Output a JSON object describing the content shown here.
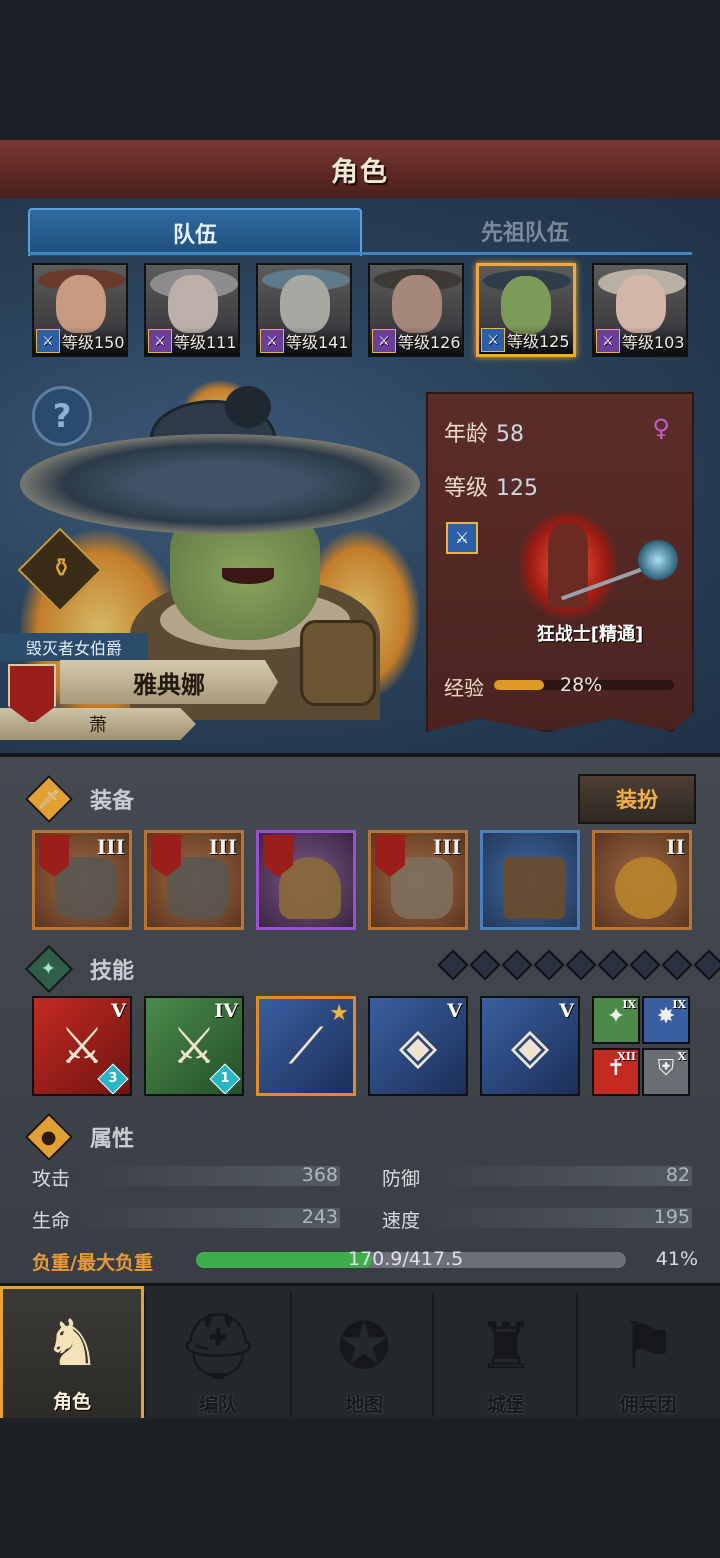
{
  "header": {
    "title": "角色"
  },
  "tabs": [
    {
      "label": "队伍"
    },
    {
      "label": "先祖队伍"
    }
  ],
  "roster": [
    {
      "level_text": "等级150",
      "class_color": "blue"
    },
    {
      "level_text": "等级111",
      "class_color": "purple"
    },
    {
      "level_text": "等级141",
      "class_color": "purple"
    },
    {
      "level_text": "等级126",
      "class_color": "purple"
    },
    {
      "level_text": "等级125",
      "class_color": "blue",
      "selected": true
    },
    {
      "level_text": "等级103",
      "class_color": "purple"
    }
  ],
  "character": {
    "title": "毁灭者女伯爵",
    "name": "雅典娜",
    "subname": "萧",
    "info": {
      "age_label": "年龄",
      "age": "58",
      "level_label": "等级",
      "level": "125",
      "gender_icon": "♀",
      "class_name": "狂战士[精通]",
      "exp_label": "经验",
      "exp_percent": "28%",
      "exp_fraction": 0.28
    }
  },
  "equipment": {
    "label": "装备",
    "dress_button": "装扮",
    "items": [
      {
        "name": "equip-spiked-pauldron-1",
        "rank": "III",
        "rarity": "orange",
        "flag": true
      },
      {
        "name": "equip-spiked-pauldron-2",
        "rank": "III",
        "rarity": "orange",
        "flag": true
      },
      {
        "name": "equip-helmet",
        "rank": "",
        "rarity": "purple",
        "flag": true
      },
      {
        "name": "equip-fur-armor",
        "rank": "III",
        "rarity": "orange",
        "flag": true
      },
      {
        "name": "equip-leather-boots",
        "rank": "",
        "rarity": "blue",
        "flag": false
      },
      {
        "name": "equip-bat-amulet",
        "rank": "II",
        "rarity": "orange",
        "flag": false
      }
    ]
  },
  "skills": {
    "label": "技能",
    "slots_total": 9,
    "items": [
      {
        "rank": "V",
        "color": "red",
        "count": "3",
        "symbol": "⚔"
      },
      {
        "rank": "IV",
        "color": "green",
        "count": "1",
        "symbol": "⚔"
      },
      {
        "rank": "",
        "color": "blue",
        "star": true,
        "selected": true,
        "symbol": "⟋"
      },
      {
        "rank": "V",
        "color": "blue",
        "symbol": "◈"
      },
      {
        "rank": "V",
        "color": "blue",
        "symbol": "◈"
      }
    ],
    "passives": [
      {
        "rank": "IX",
        "color": "#4c8a4a",
        "symbol": "✦"
      },
      {
        "rank": "IX",
        "color": "#3a5fa0",
        "symbol": "✸"
      },
      {
        "rank": "XII",
        "color": "#c32a22",
        "symbol": "✝"
      },
      {
        "rank": "X",
        "color": "#6a6e74",
        "symbol": "⛨"
      }
    ]
  },
  "attributes": {
    "label": "属性",
    "attack_label": "攻击",
    "attack": "368",
    "defense_label": "防御",
    "defense": "82",
    "hp_label": "生命",
    "hp": "243",
    "speed_label": "速度",
    "speed": "195",
    "load_label": "负重/最大负重",
    "load_text": "170.9/417.5",
    "load_percent": "41%",
    "load_fraction": 0.41
  },
  "nav": [
    {
      "label": "角色",
      "icon": "knight-icon",
      "glyph": "♞",
      "active": true
    },
    {
      "label": "编队",
      "icon": "helmet-icon",
      "glyph": "⛑"
    },
    {
      "label": "地图",
      "icon": "compass-icon",
      "glyph": "✪"
    },
    {
      "label": "城堡",
      "icon": "castle-icon",
      "glyph": "♜"
    },
    {
      "label": "佣兵团",
      "icon": "banner-icon",
      "glyph": "⚑"
    }
  ]
}
